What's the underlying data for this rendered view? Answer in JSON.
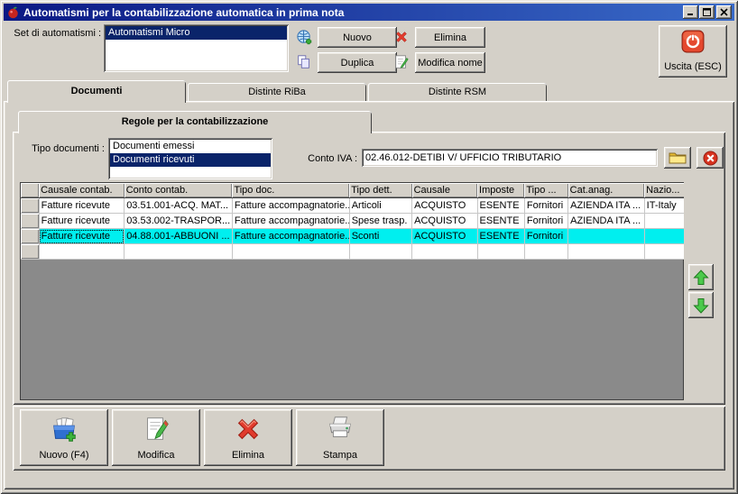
{
  "window": {
    "title": "Automatismi per la contabilizzazione automatica in prima nota"
  },
  "header": {
    "set_label": "Set di automatismi :",
    "set_list": [
      {
        "label": "Automatismi Micro",
        "selected": true
      }
    ],
    "nuovo_label": "Nuovo",
    "elimina_label": "Elimina",
    "duplica_label": "Duplica",
    "modifica_nome_label": "Modifica nome",
    "uscita_label": "Uscita (ESC)"
  },
  "tabs": [
    {
      "label": "Documenti",
      "active": true
    },
    {
      "label": "Distinte RiBa",
      "active": false
    },
    {
      "label": "Distinte RSM",
      "active": false
    }
  ],
  "inner_tab": {
    "label": "Regole per la contabilizzazione",
    "active": true
  },
  "filters": {
    "tipo_label": "Tipo documenti :",
    "tipo_list": [
      {
        "label": "Documenti emessi",
        "selected": false
      },
      {
        "label": "Documenti ricevuti",
        "selected": true
      }
    ],
    "conto_iva_label": "Conto IVA :",
    "conto_iva_value": "02.46.012-DETIBI V/ UFFICIO TRIBUTARIO"
  },
  "table": {
    "columns": [
      "",
      "Causale contab.",
      "Conto contab.",
      "Tipo doc.",
      "Tipo dett.",
      "Causale",
      "Imposte",
      "Tipo ...",
      "Cat.anag.",
      "Nazio..."
    ],
    "rows": [
      [
        "Fatture ricevute",
        "03.51.001-ACQ. MAT...",
        "Fatture accompagnatorie...",
        "Articoli",
        "ACQUISTO",
        "ESENTE",
        "Fornitori",
        "AZIENDA ITA ...",
        "IT-Italy"
      ],
      [
        "Fatture ricevute",
        "03.53.002-TRASPOR...",
        "Fatture accompagnatorie...",
        "Spese trasp.",
        "ACQUISTO",
        "ESENTE",
        "Fornitori",
        "AZIENDA ITA ...",
        ""
      ],
      [
        "Fatture ricevute",
        "04.88.001-ABBUONI ...",
        "Fatture accompagnatorie...",
        "Sconti",
        "ACQUISTO",
        "ESENTE",
        "Fornitori",
        "",
        ""
      ],
      [
        "",
        "",
        "",
        "",
        "",
        "",
        "",
        "",
        ""
      ]
    ],
    "selected_row_index": 2
  },
  "toolbar": {
    "nuovo_f4_label": "Nuovo (F4)",
    "modifica_label": "Modifica",
    "elimina_label": "Elimina",
    "stampa_label": "Stampa"
  },
  "icons": {
    "app": "apple-icon",
    "new_set": "globe-add-icon",
    "delete_set": "red-x-icon",
    "duplicate_set": "copy-icon",
    "rename_set": "edit-note-icon",
    "exit": "power-icon",
    "conto_lookup": "folder-icon",
    "conto_clear": "clear-circle-icon",
    "move_up": "arrow-up-icon",
    "move_down": "arrow-down-icon",
    "new_rule": "box-add-icon",
    "edit_rule": "edit-note-icon",
    "delete_rule": "red-x-icon",
    "print": "printer-icon"
  },
  "colors": {
    "chrome": "#d4d0c8",
    "titlebar_start": "#0b1984",
    "titlebar_end": "#3a6bc9",
    "selection_navy": "#0a246a",
    "row_selected_cyan": "#00efef",
    "grid_empty_gray": "#8a8a8a"
  }
}
